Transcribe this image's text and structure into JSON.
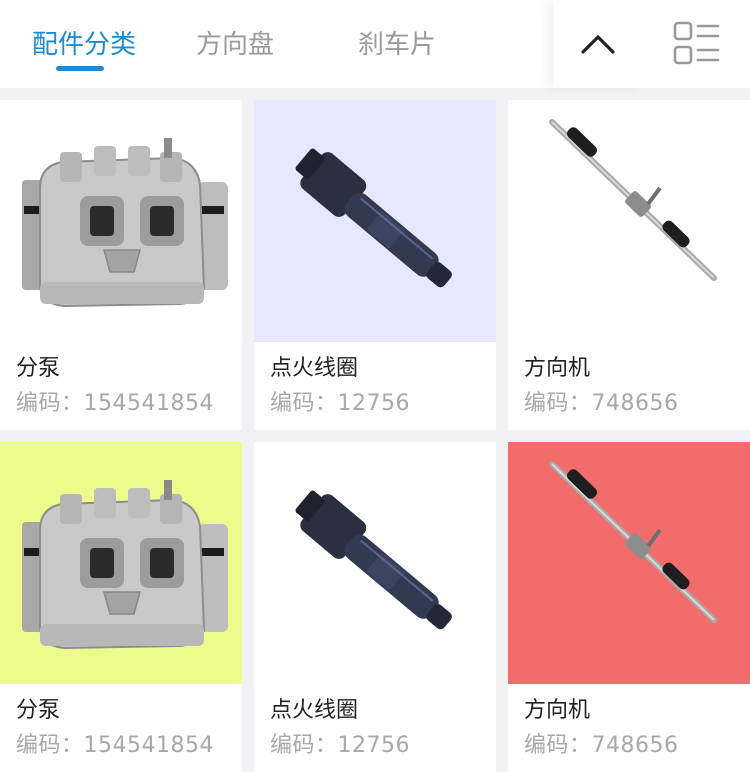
{
  "tabs": [
    {
      "label": "配件分类",
      "active": true
    },
    {
      "label": "方向盘",
      "active": false
    },
    {
      "label": "刹车片",
      "active": false
    }
  ],
  "accent_color": "#1a8cd6",
  "toolbar": {
    "collapse_icon": "chevron-up-icon",
    "layout_icon": "list-view-icon"
  },
  "products": [
    {
      "name": "分泵",
      "code_label": "编码：",
      "code": "154541854",
      "image": "brake-caliper",
      "bg": "#ffffff"
    },
    {
      "name": "点火线圈",
      "code_label": "编码：",
      "code": "12756",
      "image": "ignition-coil",
      "bg": "#e7e8ff"
    },
    {
      "name": "方向机",
      "code_label": "编码：",
      "code": "748656",
      "image": "steering-rack",
      "bg": "#ffffff"
    },
    {
      "name": "分泵",
      "code_label": "编码：",
      "code": "154541854",
      "image": "brake-caliper",
      "bg": "#ecfb8c"
    },
    {
      "name": "点火线圈",
      "code_label": "编码：",
      "code": "12756",
      "image": "ignition-coil",
      "bg": "#ffffff"
    },
    {
      "name": "方向机",
      "code_label": "编码：",
      "code": "748656",
      "image": "steering-rack",
      "bg": "#f26c6c"
    }
  ]
}
